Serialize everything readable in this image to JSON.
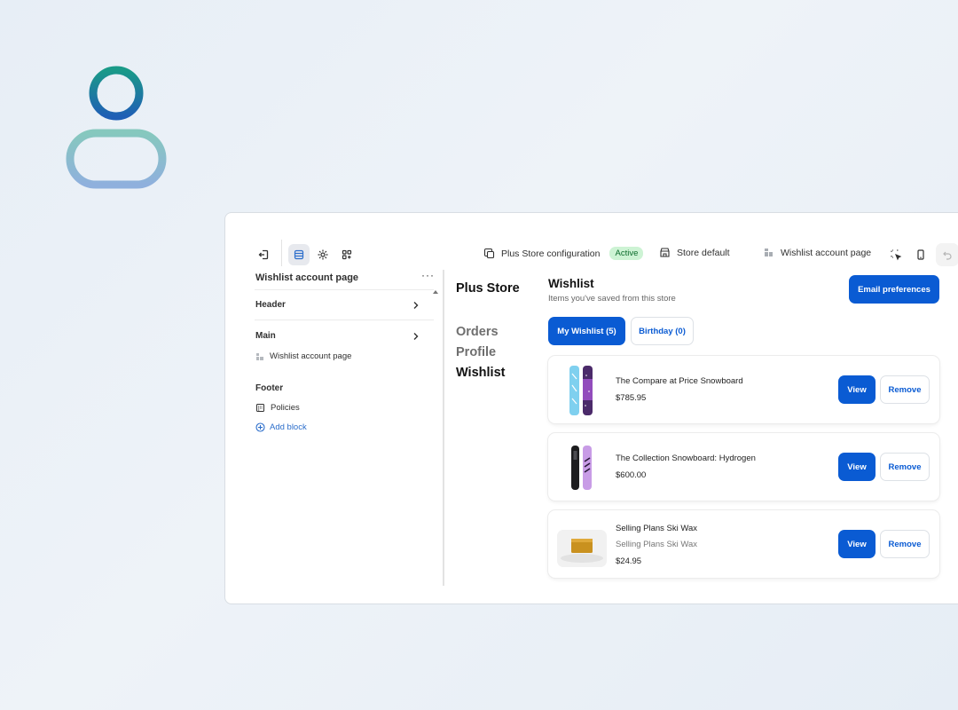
{
  "toolbar": {
    "config_label": "Plus Store configuration",
    "config_status": "Active",
    "store_label": "Store default",
    "page_label": "Wishlist account page"
  },
  "sidebar": {
    "title": "Wishlist account page",
    "more": "···",
    "sections": {
      "header": "Header",
      "main": "Main",
      "main_block": "Wishlist account page",
      "footer": "Footer",
      "footer_block": "Policies",
      "add_block": "Add block"
    }
  },
  "preview": {
    "store_name": "Plus Store",
    "nav": [
      {
        "label": "Orders",
        "active": false
      },
      {
        "label": "Profile",
        "active": false
      },
      {
        "label": "Wishlist",
        "active": true
      }
    ],
    "wishlist_title": "Wishlist",
    "wishlist_subtitle": "Items you've saved from this store",
    "email_button": "Email preferences",
    "tabs": [
      {
        "label": "My Wishlist (5)",
        "active": true
      },
      {
        "label": "Birthday (0)",
        "active": false
      }
    ],
    "items": [
      {
        "name": "The Compare at Price Snowboard",
        "variant": "",
        "price": "$785.95",
        "view": "View",
        "remove": "Remove"
      },
      {
        "name": "The Collection Snowboard: Hydrogen",
        "variant": "",
        "price": "$600.00",
        "view": "View",
        "remove": "Remove"
      },
      {
        "name": "Selling Plans Ski Wax",
        "variant": "Selling Plans Ski Wax",
        "price": "$24.95",
        "view": "View",
        "remove": "Remove"
      }
    ]
  },
  "colors": {
    "primary": "#0a5bd3",
    "active_badge_bg": "#cdf3d4",
    "active_badge_text": "#0b6b2b"
  }
}
